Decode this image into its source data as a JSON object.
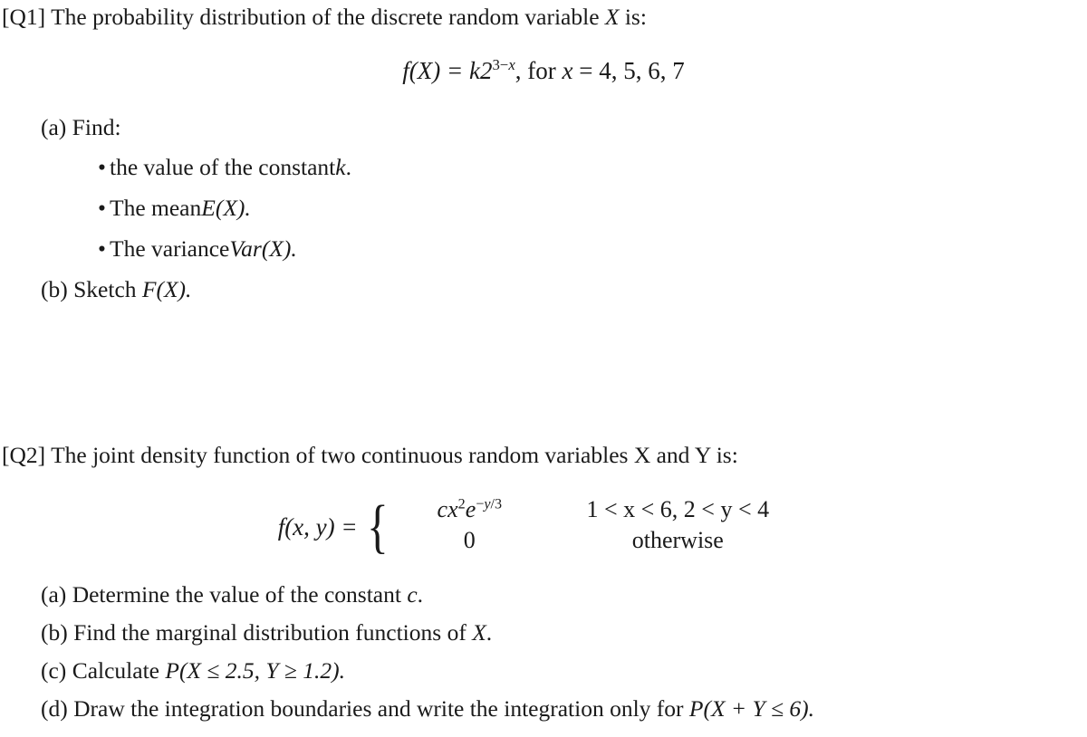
{
  "document": {
    "background_color": "#ffffff",
    "text_color": "#1a1a1a"
  },
  "q1": {
    "header_prefix": "[Q1] The probability distribution of the discrete random variable ",
    "header_var": "X",
    "header_suffix": " is:",
    "equation": {
      "lhs": "f(X) = k2",
      "exponent_num": "3",
      "exponent_minus": "−",
      "exponent_var": "x",
      "rhs": ", for ",
      "rhs_var": "x",
      "rhs_values": " = 4, 5, 6, 7"
    },
    "part_a_label": "(a) Find:",
    "bullets": [
      {
        "marker": "•",
        "text_before": "the value of the constant ",
        "var": "k",
        "text_after": "."
      },
      {
        "marker": "•",
        "text_before": "The mean ",
        "var": "E",
        "text_after": "(X)."
      },
      {
        "marker": "•",
        "text_before": "The variance ",
        "var": "Var",
        "text_after": "(X)."
      }
    ],
    "part_b": "(b) Sketch ",
    "part_b_var": "F",
    "part_b_after": "(X)."
  },
  "q2": {
    "header": "[Q2] The joint density function of two continuous random variables X and Y is:",
    "equation": {
      "lhs": "f(x, y) =",
      "brace": "{",
      "case1_value_c": "cx",
      "case1_value_sup": "2",
      "case1_value_e": "e",
      "case1_value_exp_minus": "−",
      "case1_value_exp_y": "y",
      "case1_value_exp_div": "/3",
      "case1_condition": "1 < x < 6, 2 < y < 4",
      "case2_value": "0",
      "case2_condition": "otherwise"
    },
    "parts": [
      {
        "label": "(a)",
        "text": "Determine the value of the constant ",
        "var": "c",
        "after": "."
      },
      {
        "label": "(b)",
        "text": "Find the marginal distribution functions of ",
        "var": "X",
        "after": "."
      },
      {
        "label": "(c)",
        "text": "Calculate ",
        "var": "P",
        "after": "(X ≤ 2.5, Y ≥ 1.2)."
      },
      {
        "label": "(d)",
        "text": "Draw the integration boundaries and write the integration only for ",
        "var": "P",
        "after": "(X + Y ≤ 6)."
      }
    ]
  }
}
